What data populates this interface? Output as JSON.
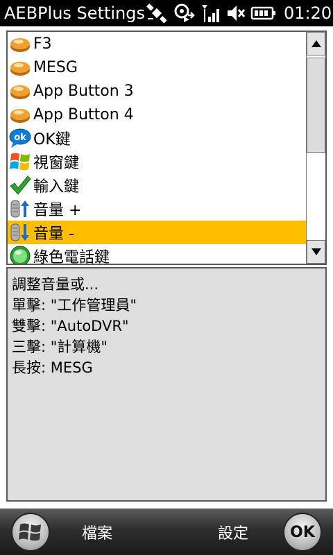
{
  "status_bar": {
    "title": "AEBPlus Settings",
    "time": "01:20",
    "icons": [
      "satellite-icon",
      "sync-icon",
      "signal-icon",
      "volume-muted-icon",
      "battery-icon"
    ]
  },
  "key_list": {
    "items": [
      {
        "label": "F3",
        "icon": "orange-button-icon",
        "selected": false
      },
      {
        "label": "MESG",
        "icon": "orange-button-icon",
        "selected": false
      },
      {
        "label": "App Button 3",
        "icon": "orange-button-icon",
        "selected": false
      },
      {
        "label": "App Button 4",
        "icon": "orange-button-icon",
        "selected": false
      },
      {
        "label": "OK鍵",
        "icon": "ok-bubble-icon",
        "selected": false
      },
      {
        "label": "視窗鍵",
        "icon": "windows-flag-icon",
        "selected": false
      },
      {
        "label": "輸入鍵",
        "icon": "checkmark-icon",
        "selected": false
      },
      {
        "label": "音量 +",
        "icon": "volume-up-icon",
        "selected": false
      },
      {
        "label": "音量 -",
        "icon": "volume-down-icon",
        "selected": true
      },
      {
        "label": "綠色電話鍵",
        "icon": "green-phone-icon",
        "selected": false
      }
    ]
  },
  "description": {
    "lines": [
      "調整音量或...",
      "單擊: \"工作管理員\"",
      "雙擊: \"AutoDVR\"",
      "三擊: \"計算機\"",
      "長按: MESG"
    ]
  },
  "menu_bar": {
    "left_softkey": "檔案",
    "right_softkey": "設定",
    "ok_label": "OK"
  },
  "colors": {
    "selection": "#ffbf00",
    "panel_bg": "#dedede"
  }
}
